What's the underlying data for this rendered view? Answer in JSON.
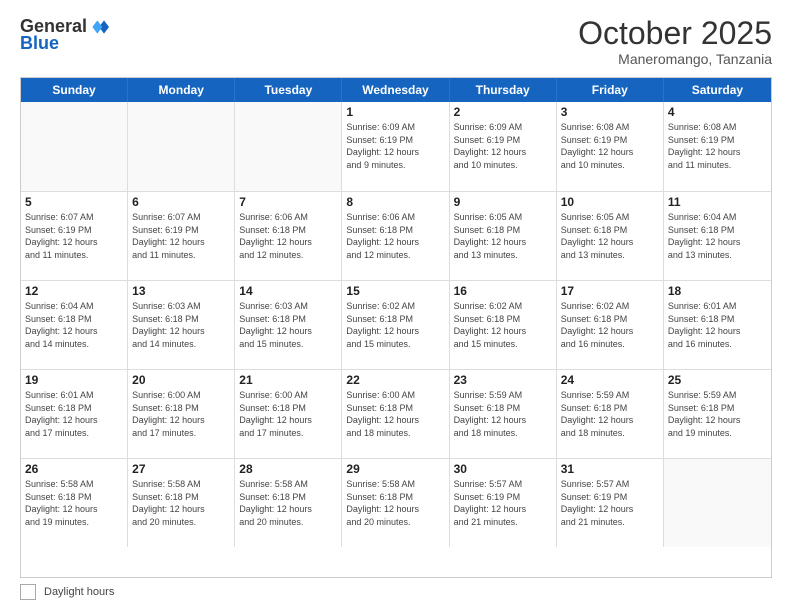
{
  "header": {
    "logo": {
      "general": "General",
      "blue": "Blue"
    },
    "title": "October 2025",
    "location": "Maneromango, Tanzania"
  },
  "weekdays": [
    "Sunday",
    "Monday",
    "Tuesday",
    "Wednesday",
    "Thursday",
    "Friday",
    "Saturday"
  ],
  "weeks": [
    [
      {
        "day": "",
        "text": ""
      },
      {
        "day": "",
        "text": ""
      },
      {
        "day": "",
        "text": ""
      },
      {
        "day": "1",
        "text": "Sunrise: 6:09 AM\nSunset: 6:19 PM\nDaylight: 12 hours\nand 9 minutes."
      },
      {
        "day": "2",
        "text": "Sunrise: 6:09 AM\nSunset: 6:19 PM\nDaylight: 12 hours\nand 10 minutes."
      },
      {
        "day": "3",
        "text": "Sunrise: 6:08 AM\nSunset: 6:19 PM\nDaylight: 12 hours\nand 10 minutes."
      },
      {
        "day": "4",
        "text": "Sunrise: 6:08 AM\nSunset: 6:19 PM\nDaylight: 12 hours\nand 11 minutes."
      }
    ],
    [
      {
        "day": "5",
        "text": "Sunrise: 6:07 AM\nSunset: 6:19 PM\nDaylight: 12 hours\nand 11 minutes."
      },
      {
        "day": "6",
        "text": "Sunrise: 6:07 AM\nSunset: 6:19 PM\nDaylight: 12 hours\nand 11 minutes."
      },
      {
        "day": "7",
        "text": "Sunrise: 6:06 AM\nSunset: 6:18 PM\nDaylight: 12 hours\nand 12 minutes."
      },
      {
        "day": "8",
        "text": "Sunrise: 6:06 AM\nSunset: 6:18 PM\nDaylight: 12 hours\nand 12 minutes."
      },
      {
        "day": "9",
        "text": "Sunrise: 6:05 AM\nSunset: 6:18 PM\nDaylight: 12 hours\nand 13 minutes."
      },
      {
        "day": "10",
        "text": "Sunrise: 6:05 AM\nSunset: 6:18 PM\nDaylight: 12 hours\nand 13 minutes."
      },
      {
        "day": "11",
        "text": "Sunrise: 6:04 AM\nSunset: 6:18 PM\nDaylight: 12 hours\nand 13 minutes."
      }
    ],
    [
      {
        "day": "12",
        "text": "Sunrise: 6:04 AM\nSunset: 6:18 PM\nDaylight: 12 hours\nand 14 minutes."
      },
      {
        "day": "13",
        "text": "Sunrise: 6:03 AM\nSunset: 6:18 PM\nDaylight: 12 hours\nand 14 minutes."
      },
      {
        "day": "14",
        "text": "Sunrise: 6:03 AM\nSunset: 6:18 PM\nDaylight: 12 hours\nand 15 minutes."
      },
      {
        "day": "15",
        "text": "Sunrise: 6:02 AM\nSunset: 6:18 PM\nDaylight: 12 hours\nand 15 minutes."
      },
      {
        "day": "16",
        "text": "Sunrise: 6:02 AM\nSunset: 6:18 PM\nDaylight: 12 hours\nand 15 minutes."
      },
      {
        "day": "17",
        "text": "Sunrise: 6:02 AM\nSunset: 6:18 PM\nDaylight: 12 hours\nand 16 minutes."
      },
      {
        "day": "18",
        "text": "Sunrise: 6:01 AM\nSunset: 6:18 PM\nDaylight: 12 hours\nand 16 minutes."
      }
    ],
    [
      {
        "day": "19",
        "text": "Sunrise: 6:01 AM\nSunset: 6:18 PM\nDaylight: 12 hours\nand 17 minutes."
      },
      {
        "day": "20",
        "text": "Sunrise: 6:00 AM\nSunset: 6:18 PM\nDaylight: 12 hours\nand 17 minutes."
      },
      {
        "day": "21",
        "text": "Sunrise: 6:00 AM\nSunset: 6:18 PM\nDaylight: 12 hours\nand 17 minutes."
      },
      {
        "day": "22",
        "text": "Sunrise: 6:00 AM\nSunset: 6:18 PM\nDaylight: 12 hours\nand 18 minutes."
      },
      {
        "day": "23",
        "text": "Sunrise: 5:59 AM\nSunset: 6:18 PM\nDaylight: 12 hours\nand 18 minutes."
      },
      {
        "day": "24",
        "text": "Sunrise: 5:59 AM\nSunset: 6:18 PM\nDaylight: 12 hours\nand 18 minutes."
      },
      {
        "day": "25",
        "text": "Sunrise: 5:59 AM\nSunset: 6:18 PM\nDaylight: 12 hours\nand 19 minutes."
      }
    ],
    [
      {
        "day": "26",
        "text": "Sunrise: 5:58 AM\nSunset: 6:18 PM\nDaylight: 12 hours\nand 19 minutes."
      },
      {
        "day": "27",
        "text": "Sunrise: 5:58 AM\nSunset: 6:18 PM\nDaylight: 12 hours\nand 20 minutes."
      },
      {
        "day": "28",
        "text": "Sunrise: 5:58 AM\nSunset: 6:18 PM\nDaylight: 12 hours\nand 20 minutes."
      },
      {
        "day": "29",
        "text": "Sunrise: 5:58 AM\nSunset: 6:18 PM\nDaylight: 12 hours\nand 20 minutes."
      },
      {
        "day": "30",
        "text": "Sunrise: 5:57 AM\nSunset: 6:19 PM\nDaylight: 12 hours\nand 21 minutes."
      },
      {
        "day": "31",
        "text": "Sunrise: 5:57 AM\nSunset: 6:19 PM\nDaylight: 12 hours\nand 21 minutes."
      },
      {
        "day": "",
        "text": ""
      }
    ]
  ],
  "footer": {
    "label": "Daylight hours"
  }
}
